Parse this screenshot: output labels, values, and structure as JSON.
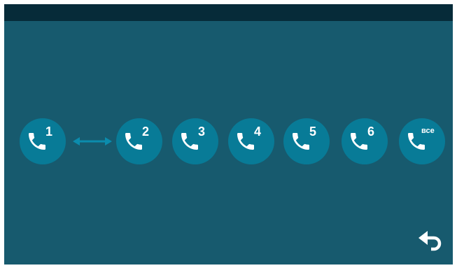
{
  "colors": {
    "background": "#175a6e",
    "topbar": "#062b39",
    "button": "#087b97",
    "arrow": "#0b8cad",
    "icon": "#ffffff"
  },
  "buttons": [
    {
      "label": "1",
      "icon": "phone-icon"
    },
    {
      "label": "2",
      "icon": "phone-icon"
    },
    {
      "label": "3",
      "icon": "phone-icon"
    },
    {
      "label": "4",
      "icon": "phone-icon"
    },
    {
      "label": "5",
      "icon": "phone-icon"
    },
    {
      "label": "6",
      "icon": "phone-icon"
    },
    {
      "label": "все",
      "icon": "phone-icon"
    }
  ],
  "link_icon": "double-arrow-icon",
  "back_icon": "back-arrow-icon"
}
